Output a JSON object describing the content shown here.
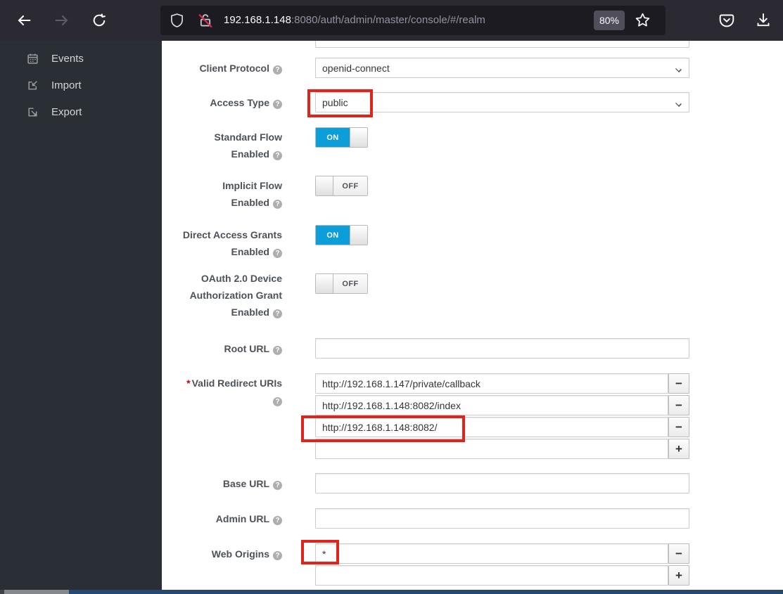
{
  "browser": {
    "url_host": "192.168.1.148",
    "url_rest": ":8080/auth/admin/master/console/#/realm",
    "zoom_badge": "80%"
  },
  "sidebar": {
    "items": [
      {
        "label": "Events"
      },
      {
        "label": "Import"
      },
      {
        "label": "Export"
      }
    ]
  },
  "form": {
    "client_protocol": {
      "label": "Client Protocol",
      "value": "openid-connect"
    },
    "access_type": {
      "label": "Access Type",
      "value": "public"
    },
    "standard_flow": {
      "line1": "Standard Flow",
      "line2": "Enabled",
      "state": "ON"
    },
    "implicit_flow": {
      "line1": "Implicit Flow",
      "line2": "Enabled",
      "state": "OFF"
    },
    "direct_access_grants": {
      "line1": "Direct Access Grants",
      "line2": "Enabled",
      "state": "ON"
    },
    "oauth_device": {
      "line1": "OAuth 2.0 Device",
      "line2": "Authorization Grant",
      "line3": "Enabled",
      "state": "OFF"
    },
    "root_url": {
      "label": "Root URL",
      "value": ""
    },
    "valid_redirect_uris": {
      "required_mark": "*",
      "label": "Valid Redirect URIs",
      "values": [
        "http://192.168.1.147/private/callback",
        "http://192.168.1.148:8082/index",
        "http://192.168.1.148:8082/"
      ],
      "new_value": "",
      "remove_label": "−",
      "add_label": "+"
    },
    "base_url": {
      "label": "Base URL",
      "value": ""
    },
    "admin_url": {
      "label": "Admin URL",
      "value": ""
    },
    "web_origins": {
      "label": "Web Origins",
      "values": [
        "*"
      ],
      "new_value": "",
      "remove_label": "−",
      "add_label": "+"
    }
  },
  "colors": {
    "accent_blue": "#0b9ed9",
    "annotation_red": "#e0241c"
  }
}
